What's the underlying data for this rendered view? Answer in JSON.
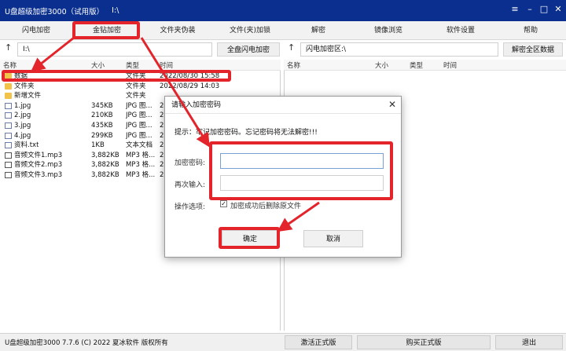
{
  "window": {
    "title": "U盘超级加密3000（试用版）",
    "path": "I:\\"
  },
  "toolbar": {
    "items": [
      "闪电加密",
      "金钻加密",
      "文件夹伪装",
      "文件(夹)加锁",
      "解密",
      "镜像浏览",
      "软件设置",
      "帮助"
    ]
  },
  "left_pane": {
    "path": "I:\\",
    "button": "全盘闪电加密",
    "columns": [
      "名称",
      "大小",
      "类型",
      "时间"
    ],
    "files": [
      {
        "name": "数据",
        "size": "",
        "type": "文件夹",
        "time": "2022/08/30 15:58",
        "icon": "folder"
      },
      {
        "name": "文件夹",
        "size": "",
        "type": "文件夹",
        "time": "2022/08/29 14:03",
        "icon": "folder"
      },
      {
        "name": "新增文件",
        "size": "",
        "type": "文件夹",
        "time": "",
        "icon": "folder"
      },
      {
        "name": "1.jpg",
        "size": "345KB",
        "type": "JPG 图...",
        "time": "2",
        "icon": "image"
      },
      {
        "name": "2.jpg",
        "size": "210KB",
        "type": "JPG 图...",
        "time": "2",
        "icon": "image"
      },
      {
        "name": "3.jpg",
        "size": "435KB",
        "type": "JPG 图...",
        "time": "2",
        "icon": "image"
      },
      {
        "name": "4.jpg",
        "size": "299KB",
        "type": "JPG 图...",
        "time": "2",
        "icon": "image"
      },
      {
        "name": "资料.txt",
        "size": "1KB",
        "type": "文本文档",
        "time": "2",
        "icon": "text"
      },
      {
        "name": "音频文件1.mp3",
        "size": "3,882KB",
        "type": "MP3 格...",
        "time": "2",
        "icon": "audio"
      },
      {
        "name": "音频文件2.mp3",
        "size": "3,882KB",
        "type": "MP3 格...",
        "time": "2",
        "icon": "audio"
      },
      {
        "name": "音频文件3.mp3",
        "size": "3,882KB",
        "type": "MP3 格...",
        "time": "2",
        "icon": "audio"
      }
    ]
  },
  "right_pane": {
    "path": "闪电加密区:\\",
    "button": "解密全区数据",
    "columns": [
      "名称",
      "大小",
      "类型",
      "时间"
    ]
  },
  "dialog": {
    "title": "请输入加密密码",
    "hint": "提示：牢记加密密码。忘记密码将无法解密!!!",
    "password_label": "加密密码:",
    "confirm_label": "再次输入:",
    "options_label": "操作选项:",
    "checkbox_label": "加密成功后删除原文件",
    "checkbox_checked": true,
    "ok": "确定",
    "cancel": "取消"
  },
  "statusbar": {
    "version": "U盘超级加密3000 7.7.6 (C) 2022 夏冰软件 版权所有",
    "activate": "激活正式版",
    "buy": "购买正式版",
    "exit": "退出"
  },
  "colors": {
    "titlebar": "#0a2f8e",
    "highlight": "#e3242b"
  }
}
